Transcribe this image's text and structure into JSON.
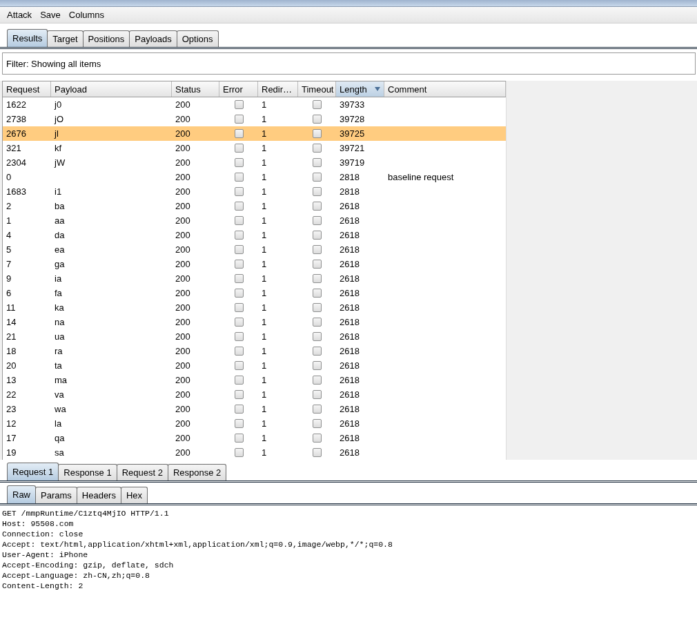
{
  "menu": [
    "Attack",
    "Save",
    "Columns"
  ],
  "tabs": [
    {
      "label": "Results",
      "selected": true
    },
    {
      "label": "Target",
      "selected": false
    },
    {
      "label": "Positions",
      "selected": false
    },
    {
      "label": "Payloads",
      "selected": false
    },
    {
      "label": "Options",
      "selected": false
    }
  ],
  "filter": "Filter: Showing all items",
  "table": {
    "columns": [
      {
        "label": "Request",
        "sorted": false
      },
      {
        "label": "Payload",
        "sorted": false
      },
      {
        "label": "Status",
        "sorted": false
      },
      {
        "label": "Error",
        "sorted": false
      },
      {
        "label": "Redir…",
        "sorted": false
      },
      {
        "label": "Timeout",
        "sorted": false
      },
      {
        "label": "Length",
        "sorted": true
      },
      {
        "label": "Comment",
        "sorted": false
      }
    ],
    "rows": [
      {
        "request": "1622",
        "payload": "j0",
        "status": "200",
        "error": false,
        "redir": "1",
        "timeout": false,
        "length": "39733",
        "comment": "",
        "selected": false
      },
      {
        "request": "2738",
        "payload": "jO",
        "status": "200",
        "error": false,
        "redir": "1",
        "timeout": false,
        "length": "39728",
        "comment": "",
        "selected": false
      },
      {
        "request": "2676",
        "payload": "jl",
        "status": "200",
        "error": false,
        "redir": "1",
        "timeout": false,
        "length": "39725",
        "comment": "",
        "selected": true
      },
      {
        "request": "321",
        "payload": "kf",
        "status": "200",
        "error": false,
        "redir": "1",
        "timeout": false,
        "length": "39721",
        "comment": "",
        "selected": false
      },
      {
        "request": "2304",
        "payload": "jW",
        "status": "200",
        "error": false,
        "redir": "1",
        "timeout": false,
        "length": "39719",
        "comment": "",
        "selected": false
      },
      {
        "request": "0",
        "payload": "",
        "status": "200",
        "error": false,
        "redir": "1",
        "timeout": false,
        "length": "2818",
        "comment": "baseline request",
        "selected": false
      },
      {
        "request": "1683",
        "payload": "i1",
        "status": "200",
        "error": false,
        "redir": "1",
        "timeout": false,
        "length": "2818",
        "comment": "",
        "selected": false
      },
      {
        "request": "2",
        "payload": "ba",
        "status": "200",
        "error": false,
        "redir": "1",
        "timeout": false,
        "length": "2618",
        "comment": "",
        "selected": false
      },
      {
        "request": "1",
        "payload": "aa",
        "status": "200",
        "error": false,
        "redir": "1",
        "timeout": false,
        "length": "2618",
        "comment": "",
        "selected": false
      },
      {
        "request": "4",
        "payload": "da",
        "status": "200",
        "error": false,
        "redir": "1",
        "timeout": false,
        "length": "2618",
        "comment": "",
        "selected": false
      },
      {
        "request": "5",
        "payload": "ea",
        "status": "200",
        "error": false,
        "redir": "1",
        "timeout": false,
        "length": "2618",
        "comment": "",
        "selected": false
      },
      {
        "request": "7",
        "payload": "ga",
        "status": "200",
        "error": false,
        "redir": "1",
        "timeout": false,
        "length": "2618",
        "comment": "",
        "selected": false
      },
      {
        "request": "9",
        "payload": "ia",
        "status": "200",
        "error": false,
        "redir": "1",
        "timeout": false,
        "length": "2618",
        "comment": "",
        "selected": false
      },
      {
        "request": "6",
        "payload": "fa",
        "status": "200",
        "error": false,
        "redir": "1",
        "timeout": false,
        "length": "2618",
        "comment": "",
        "selected": false
      },
      {
        "request": "11",
        "payload": "ka",
        "status": "200",
        "error": false,
        "redir": "1",
        "timeout": false,
        "length": "2618",
        "comment": "",
        "selected": false
      },
      {
        "request": "14",
        "payload": "na",
        "status": "200",
        "error": false,
        "redir": "1",
        "timeout": false,
        "length": "2618",
        "comment": "",
        "selected": false
      },
      {
        "request": "21",
        "payload": "ua",
        "status": "200",
        "error": false,
        "redir": "1",
        "timeout": false,
        "length": "2618",
        "comment": "",
        "selected": false
      },
      {
        "request": "18",
        "payload": "ra",
        "status": "200",
        "error": false,
        "redir": "1",
        "timeout": false,
        "length": "2618",
        "comment": "",
        "selected": false
      },
      {
        "request": "20",
        "payload": "ta",
        "status": "200",
        "error": false,
        "redir": "1",
        "timeout": false,
        "length": "2618",
        "comment": "",
        "selected": false
      },
      {
        "request": "13",
        "payload": "ma",
        "status": "200",
        "error": false,
        "redir": "1",
        "timeout": false,
        "length": "2618",
        "comment": "",
        "selected": false
      },
      {
        "request": "22",
        "payload": "va",
        "status": "200",
        "error": false,
        "redir": "1",
        "timeout": false,
        "length": "2618",
        "comment": "",
        "selected": false
      },
      {
        "request": "23",
        "payload": "wa",
        "status": "200",
        "error": false,
        "redir": "1",
        "timeout": false,
        "length": "2618",
        "comment": "",
        "selected": false
      },
      {
        "request": "12",
        "payload": "la",
        "status": "200",
        "error": false,
        "redir": "1",
        "timeout": false,
        "length": "2618",
        "comment": "",
        "selected": false
      },
      {
        "request": "17",
        "payload": "qa",
        "status": "200",
        "error": false,
        "redir": "1",
        "timeout": false,
        "length": "2618",
        "comment": "",
        "selected": false
      },
      {
        "request": "19",
        "payload": "sa",
        "status": "200",
        "error": false,
        "redir": "1",
        "timeout": false,
        "length": "2618",
        "comment": "",
        "selected": false
      }
    ]
  },
  "message_tabs": [
    {
      "label": "Request 1",
      "selected": true
    },
    {
      "label": "Response 1",
      "selected": false
    },
    {
      "label": "Request 2",
      "selected": false
    },
    {
      "label": "Response 2",
      "selected": false
    }
  ],
  "view_tabs": [
    {
      "label": "Raw",
      "selected": true
    },
    {
      "label": "Params",
      "selected": false
    },
    {
      "label": "Headers",
      "selected": false
    },
    {
      "label": "Hex",
      "selected": false
    }
  ],
  "raw_lines": [
    "GET /mmpRuntime/C1ztq4MjIO HTTP/1.1",
    "Host: 95508.com",
    "Connection: close",
    "Accept: text/html,application/xhtml+xml,application/xml;q=0.9,image/webp,*/*;q=0.8",
    "User-Agent: iPhone",
    "Accept-Encoding: gzip, deflate, sdch",
    "Accept-Language: zh-CN,zh;q=0.8",
    "Content-Length: 2"
  ]
}
